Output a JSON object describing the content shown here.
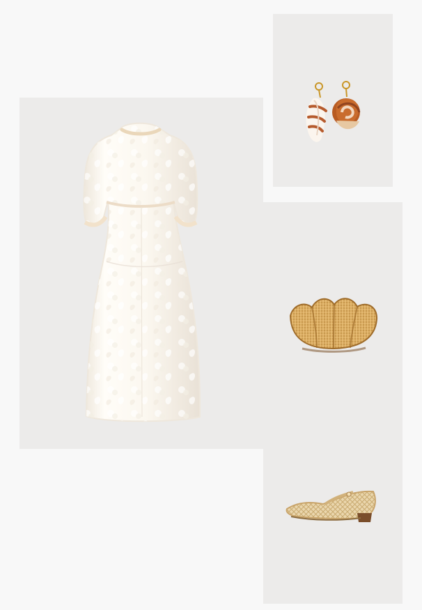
{
  "board": {
    "products": [
      {
        "icon": "white-jacquard-dress-icon"
      },
      {
        "icon": "shell-drop-earrings-icon"
      },
      {
        "icon": "wicker-shell-clutch-icon"
      },
      {
        "icon": "woven-mary-jane-shoe-icon"
      }
    ]
  },
  "colors": {
    "background": "#f8f8f8",
    "panel": "#ecebea",
    "dress": "#fbf7ef",
    "wicker": "#d8aa62",
    "shell_brown": "#9a4d25"
  }
}
